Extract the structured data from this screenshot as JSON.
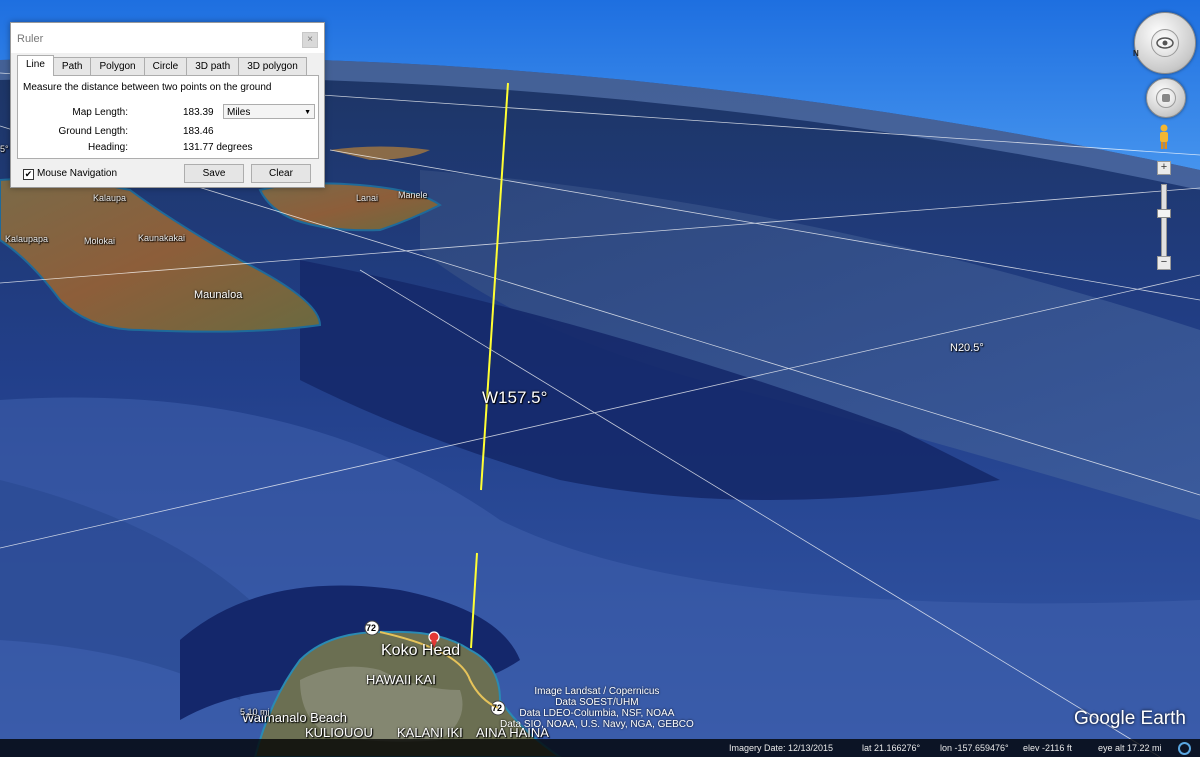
{
  "ruler": {
    "title": "Ruler",
    "close": "×",
    "tabs": [
      "Line",
      "Path",
      "Polygon",
      "Circle",
      "3D path",
      "3D polygon"
    ],
    "description": "Measure the distance between two points on the ground",
    "map_length_label": "Map Length:",
    "map_length_value": "183.39",
    "unit": "Miles",
    "ground_length_label": "Ground Length:",
    "ground_length_value": "183.46",
    "heading_label": "Heading:",
    "heading_value": "131.77 degrees",
    "mouse_nav_label": "Mouse Navigation",
    "mouse_nav_checked": true,
    "save_label": "Save",
    "clear_label": "Clear"
  },
  "map": {
    "labels": {
      "kalaupapa": "Kalaupapa",
      "molokai": "Molokai",
      "kaunakakai": "Kaunakakai",
      "maunaloa": "Maunaloa",
      "lanai": "Lanai",
      "manele": "Manele",
      "kalaupa_top": "Kalaupa",
      "meridian": "W157.5°",
      "parallel": "N20.5°",
      "edge_left": "5°",
      "koko_head": "Koko Head",
      "hawaii_kai": "HAWAII KAI",
      "waimanalo": "Waimanalo Beach",
      "kuliouou": "KULIOUOU",
      "kalani_iki": "KALANI IKI",
      "aina_haina": "AINA HAINA",
      "hwy_1": "72",
      "hwy_2": "72",
      "scale": "5.10 mi"
    },
    "ruler_line_color": "#ffff33"
  },
  "credits": [
    "Image Landsat / Copernicus",
    "Data SOEST/UHM",
    "Data LDEO-Columbia, NSF, NOAA",
    "Data SIO, NOAA, U.S. Navy, NGA, GEBCO"
  ],
  "logo": "Google Earth",
  "status": {
    "imagery_date": "Imagery Date: 12/13/2015",
    "lat": "lat   21.166276°",
    "lon": "lon -157.659476°",
    "elev": "elev -2116 ft",
    "eye_alt": "eye alt  17.22 mi"
  },
  "nav": {
    "north": "N",
    "zoom_in": "+",
    "zoom_out": "−"
  }
}
